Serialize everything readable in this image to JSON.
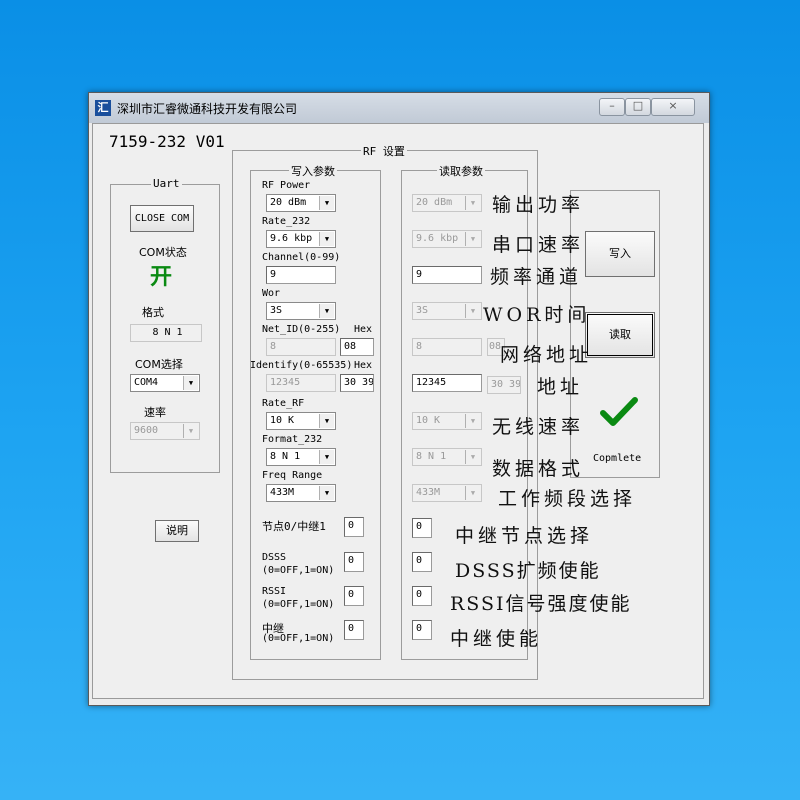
{
  "window": {
    "title": "深圳市汇睿微通科技开发有限公司",
    "icon": "汇",
    "controls": [
      "minimize-icon",
      "maximize-icon",
      "close-icon"
    ]
  },
  "app": {
    "version": "7159-232  V01"
  },
  "uart": {
    "group_title": "Uart",
    "close_com_label": "CLOSE COM",
    "com_status_label": "COM状态",
    "com_status_value": "开",
    "format_label": "格式",
    "format_value": "8  N  1",
    "com_select_label": "COM选择",
    "com_select_value": "COM4",
    "baud_label": "速率",
    "baud_value": "9600",
    "help_button": "说明"
  },
  "rf": {
    "group_title": "RF 设置",
    "write_title": "写入参数",
    "read_title": "读取参数",
    "labels": {
      "power": "RF Power",
      "rate232": "Rate_232",
      "channel": "Channel(0-99)",
      "wor": "Wor",
      "netid": "Net_ID(0-255)",
      "hex": "Hex",
      "identify": "Identify(0-65535)",
      "raterf": "Rate_RF",
      "format232": "Format_232",
      "freq": "Freq Range",
      "node": "节点0/中继1",
      "dsss": "DSSS",
      "rssi": "RSSI",
      "relay": "中继",
      "onoff": "(0=OFF,1=ON)"
    },
    "write": {
      "power": "20   dBm",
      "rate232": "9.6  kbp",
      "channel": "9",
      "wor": "3S",
      "netid": "8",
      "netid_hex": "08",
      "identify": "12345",
      "identify_hex": "30 39",
      "raterf": "10 K",
      "format232": "8 N 1",
      "freq": "433M",
      "node": "0",
      "dsss": "0",
      "rssi": "0",
      "relay": "0"
    },
    "read": {
      "power": "20   dBm",
      "rate232": "9.6  kbp",
      "channel": "9",
      "wor": "3S",
      "netid": "8",
      "netid_hex": "08",
      "identify": "12345",
      "identify_hex": "30 39",
      "raterf": "10 K",
      "format232": "8 N 1",
      "freq": "433M",
      "node": "0",
      "dsss": "0",
      "rssi": "0",
      "relay": "0"
    }
  },
  "actions": {
    "write_button": "写入",
    "read_button": "读取",
    "status": "Copmlete",
    "status_icon": "check-icon"
  },
  "annotations": {
    "power": "输出功率",
    "rate232": "串口速率",
    "channel": "频率通道",
    "wor": "WOR时间",
    "netid": "网络地址",
    "identify": "地址",
    "raterf": "无线速率",
    "format": "数据格式",
    "freq": "工作频段选择",
    "node": "中继节点选择",
    "dsss": "DSSS扩频使能",
    "rssi": "RSSI信号强度使能",
    "relay": "中继使能"
  },
  "colors": {
    "status_ok": "#0a8a12",
    "title_bar": "#c9d1dc",
    "background": "#1b9fef"
  }
}
